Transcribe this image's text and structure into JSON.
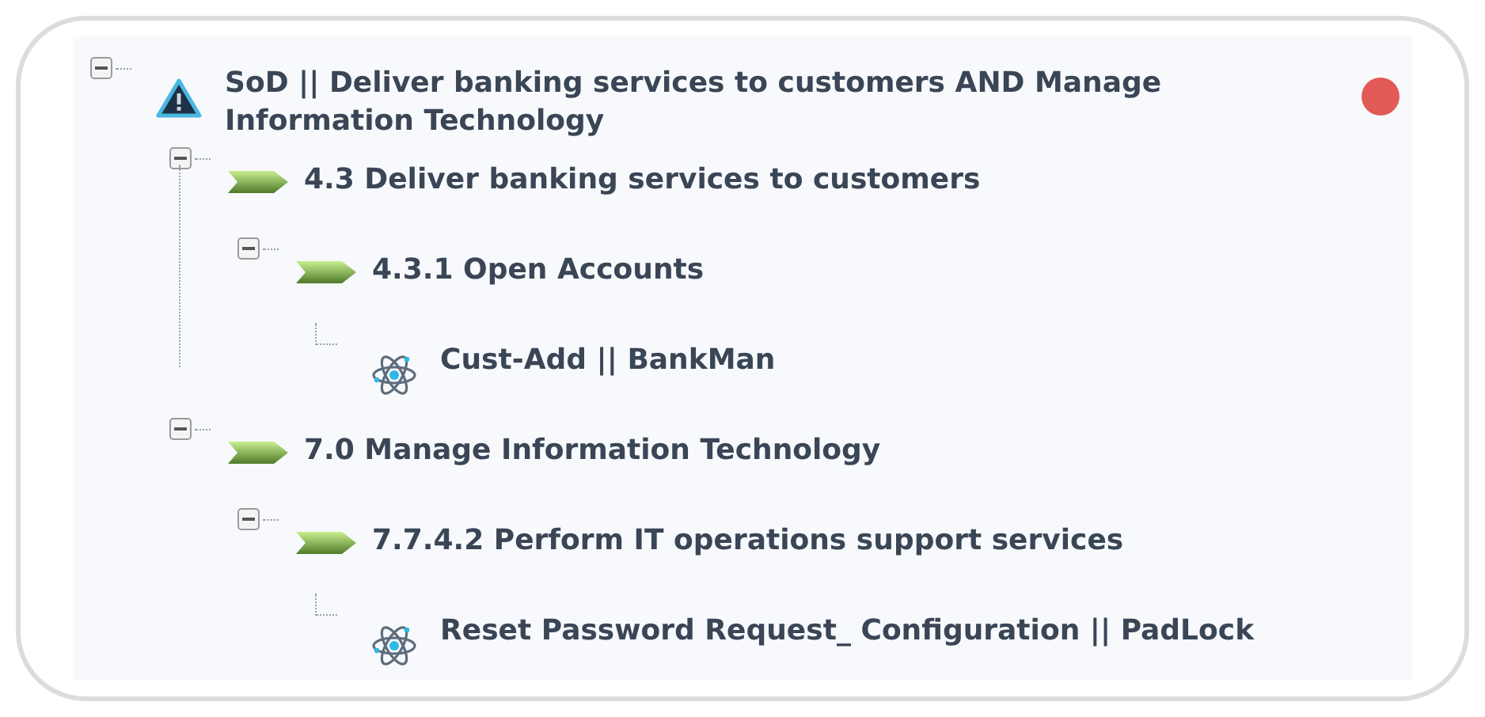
{
  "tree": [
    {
      "label": "SoD || Deliver banking services to customers AND Manage Information Technology",
      "kind": "conflict",
      "expanded": true,
      "color": "#e25a55",
      "children": [
        {
          "label": "4.3 Deliver banking services to customers",
          "kind": "process",
          "expanded": true,
          "children": [
            {
              "label": "4.3.1 Open Accounts",
              "kind": "process",
              "expanded": true,
              "children": [
                {
                  "label": "Cust-Add || BankMan",
                  "kind": "function"
                }
              ]
            }
          ]
        },
        {
          "label": "7.0 Manage Information Technology",
          "kind": "process",
          "expanded": true,
          "children": [
            {
              "label": "7.7.4.2 Perform IT operations support services",
              "kind": "process",
              "expanded": true,
              "children": [
                {
                  "label": "Reset Password Request_ Configuration || PadLock",
                  "kind": "function"
                }
              ]
            }
          ]
        }
      ]
    }
  ]
}
